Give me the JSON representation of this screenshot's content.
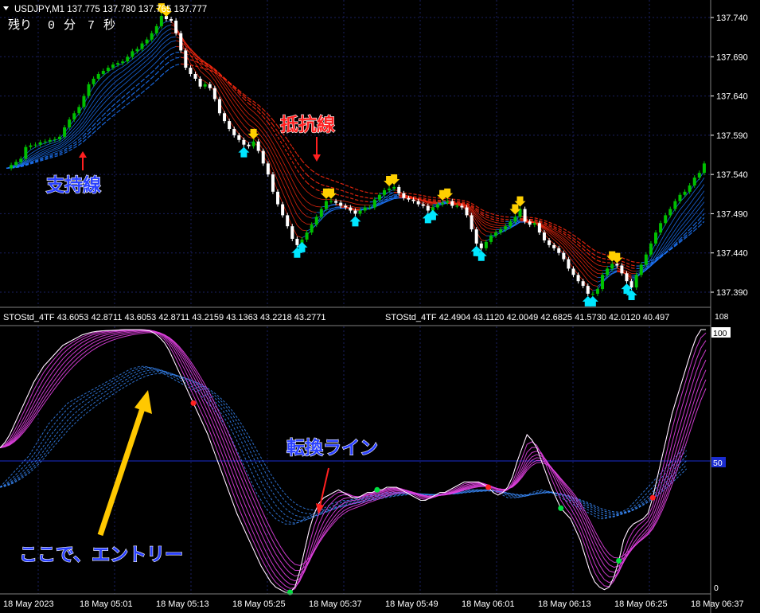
{
  "window": {
    "symbol_title": "USDJPY,M1  137.775 137.780 137.765 137.777",
    "remaining": [
      "残り",
      "0",
      "分",
      "7",
      "秒"
    ]
  },
  "colors": {
    "background": "#000000",
    "grid": "#1a1f60",
    "bull": "#00c000",
    "bear": "#ffffff",
    "resistance": "#ff2a10",
    "support": "#1e78ff",
    "stoch_main": "#e040e0",
    "stoch_signal": "#3a8cff",
    "level_line": "#1a2cd0",
    "arrow_up": "#00e6ff",
    "arrow_down": "#ffd000",
    "annot_yellow": "#ffc800",
    "annot_red": "#ff2020",
    "annot_blue": "#2a40ff"
  },
  "indicator": {
    "header_left": "STOStd_4TF 43.6053 42.8711 43.6053 42.8711 43.2159 43.1363 43.2218 43.2771",
    "header_right": "STOStd_4TF 42.4904 43.1120 42.0049 42.6825 41.5730 42.0120 40.497",
    "scale_max": "108",
    "levels": [
      "100",
      "50",
      "0"
    ]
  },
  "annotations": {
    "resistance": "抵抗線",
    "support": "支持線",
    "switch_line": "転換ライン",
    "entry": "ここで、エントリー"
  },
  "chart_data": [
    {
      "type": "candlestick",
      "title": "USDJPY,M1",
      "ylim": [
        137.37,
        137.76
      ],
      "y_ticks": [
        "137.740",
        "137.690",
        "137.640",
        "137.590",
        "137.540",
        "137.490",
        "137.440",
        "137.390"
      ],
      "current_price": "137.777",
      "closes": [
        137.548,
        137.552,
        137.556,
        137.56,
        137.575,
        137.577,
        137.578,
        137.581,
        137.582,
        137.584,
        137.585,
        137.588,
        137.6,
        137.61,
        137.618,
        137.626,
        137.64,
        137.655,
        137.662,
        137.668,
        137.672,
        137.676,
        137.68,
        137.682,
        137.684,
        137.69,
        137.697,
        137.7,
        137.707,
        137.712,
        137.72,
        137.729,
        137.742,
        137.738,
        137.736,
        137.72,
        137.698,
        137.676,
        137.668,
        137.662,
        137.652,
        137.655,
        137.65,
        137.636,
        137.618,
        137.608,
        137.598,
        137.59,
        137.584,
        137.578,
        137.576,
        137.582,
        137.57,
        137.554,
        137.54,
        137.518,
        137.502,
        137.488,
        137.474,
        137.458,
        137.45,
        137.457,
        137.466,
        137.476,
        137.486,
        137.496,
        137.506,
        137.506,
        137.504,
        137.5,
        137.498,
        137.494,
        137.49,
        137.494,
        137.498,
        137.498,
        137.508,
        137.514,
        137.52,
        137.522,
        137.524,
        137.516,
        137.51,
        137.508,
        137.506,
        137.502,
        137.5,
        137.494,
        137.498,
        137.502,
        137.504,
        137.506,
        137.5,
        137.5,
        137.498,
        137.488,
        137.47,
        137.452,
        137.446,
        137.454,
        137.462,
        137.466,
        137.47,
        137.474,
        137.48,
        137.486,
        137.496,
        137.48,
        137.476,
        137.478,
        137.466,
        137.456,
        137.45,
        137.446,
        137.44,
        137.432,
        137.42,
        137.412,
        137.404,
        137.398,
        137.388,
        137.388,
        137.394,
        137.412,
        137.42,
        137.426,
        137.424,
        137.414,
        137.404,
        137.396,
        137.412,
        137.425,
        137.438,
        137.452,
        137.466,
        137.478,
        137.488,
        137.496,
        137.506,
        137.514,
        137.518,
        137.526,
        137.536,
        137.542,
        137.554
      ],
      "x_tick_labels": [
        "18 May 2023",
        "18 May 05:01",
        "18 May 05:13",
        "18 May 05:25",
        "18 May 05:37",
        "18 May 05:49",
        "18 May 06:01",
        "18 May 06:13",
        "18 May 06:25",
        "18 May 06:37"
      ]
    },
    {
      "type": "line",
      "title": "STOStd_4TF",
      "ylim": [
        0,
        100
      ],
      "main_line": [
        55,
        57,
        60,
        64,
        68,
        72,
        76,
        80,
        83,
        86,
        88,
        90,
        92,
        94,
        95,
        96,
        97,
        98,
        98.5,
        99,
        99.3,
        99.5,
        99.6,
        99.7,
        99.8,
        99.9,
        100,
        100,
        100,
        100,
        99.8,
        99.5,
        98.5,
        97,
        95,
        92,
        88,
        84,
        80,
        76,
        72,
        68,
        64,
        60,
        55,
        50,
        45,
        40,
        35,
        30,
        26,
        22,
        18,
        14,
        10,
        7,
        4,
        2,
        1,
        0,
        0,
        2,
        8,
        16,
        24,
        30,
        34,
        36,
        37,
        38,
        39,
        38,
        37,
        36,
        36,
        37,
        38,
        38,
        39,
        39,
        40,
        40,
        40,
        39,
        38,
        37,
        36,
        35,
        35,
        36,
        37,
        38,
        38,
        39,
        40,
        41,
        42,
        42,
        42,
        42,
        41,
        40,
        38,
        37,
        38,
        40,
        44,
        50,
        55,
        60,
        58,
        55,
        50,
        45,
        40,
        36,
        32,
        30,
        28,
        24,
        20,
        14,
        8,
        4,
        2,
        1,
        2,
        6,
        12,
        20,
        24,
        26,
        27,
        28,
        30,
        36,
        44,
        52,
        60,
        68,
        74,
        80,
        86,
        92,
        97,
        100,
        100
      ],
      "signal_line": [
        40,
        42,
        44,
        46,
        48,
        50,
        52,
        55,
        58,
        61,
        64,
        66,
        68,
        70,
        72,
        73,
        74,
        75,
        76,
        77,
        78,
        79,
        80,
        81,
        82,
        83,
        84,
        85,
        85.5,
        86,
        86,
        85.5,
        85,
        84,
        83,
        82,
        81,
        80,
        79,
        78,
        77,
        76,
        74,
        72,
        70,
        68,
        65,
        62,
        58,
        54,
        50,
        46,
        42,
        38,
        35,
        32,
        30,
        28,
        27,
        26,
        26,
        26,
        27,
        28,
        29,
        30,
        31,
        32,
        33,
        34,
        34.5,
        35,
        35,
        35.5,
        36,
        36,
        36.5,
        37,
        37,
        37.5,
        38,
        38,
        38,
        38,
        38,
        38,
        37.5,
        37,
        37,
        37,
        37,
        37,
        37.5,
        38,
        38,
        38.5,
        39,
        39,
        39,
        39,
        39,
        39,
        38.5,
        38,
        37,
        36,
        36,
        36,
        36.5,
        37,
        38,
        38.5,
        39,
        38.5,
        38,
        37,
        36,
        35,
        34,
        33,
        32,
        31,
        30,
        29,
        28,
        28,
        28.5,
        29,
        30,
        31,
        32,
        34,
        36,
        38,
        40,
        42,
        44,
        46,
        48,
        50,
        52,
        54,
        56
      ]
    }
  ]
}
